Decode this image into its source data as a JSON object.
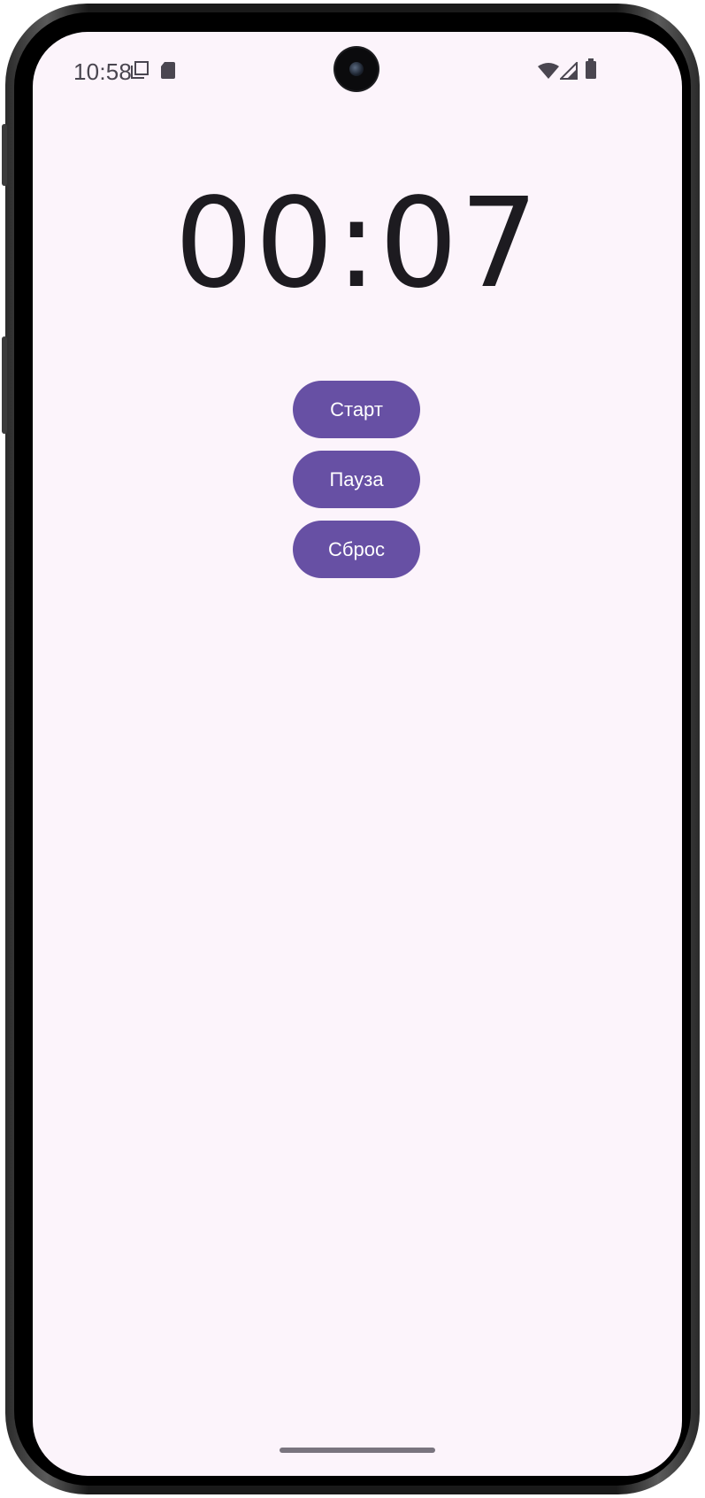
{
  "status_bar": {
    "time": "10:58",
    "icons": [
      "screen-record-icon",
      "sd-card-icon",
      "wifi-icon",
      "signal-icon",
      "battery-icon"
    ]
  },
  "stopwatch": {
    "display": "00:07"
  },
  "buttons": {
    "start_label": "Старт",
    "pause_label": "Пауза",
    "reset_label": "Сброс"
  },
  "colors": {
    "screen_background": "#fcf4fb",
    "button_background": "#6750a4",
    "button_text": "#ffffff",
    "timer_text": "#1d1b20"
  }
}
